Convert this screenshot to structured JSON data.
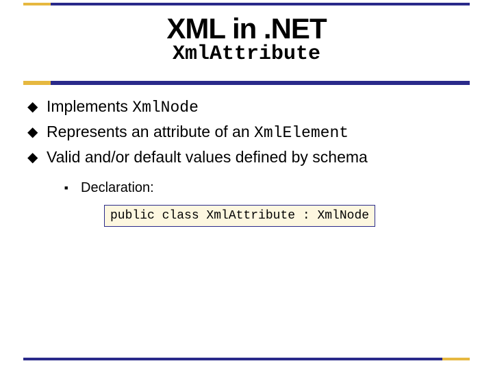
{
  "title": {
    "main": "XML in .NET",
    "sub": "XmlAttribute"
  },
  "bullets": [
    {
      "pre": "Implements ",
      "code": "XmlNode",
      "post": ""
    },
    {
      "pre": "Represents an attribute of an ",
      "code": "XmlElement",
      "post": ""
    },
    {
      "pre": "Valid and/or default values defined by schema",
      "code": "",
      "post": ""
    }
  ],
  "sub": {
    "label": "Declaration:",
    "code": "public class XmlAttribute : XmlNode"
  }
}
